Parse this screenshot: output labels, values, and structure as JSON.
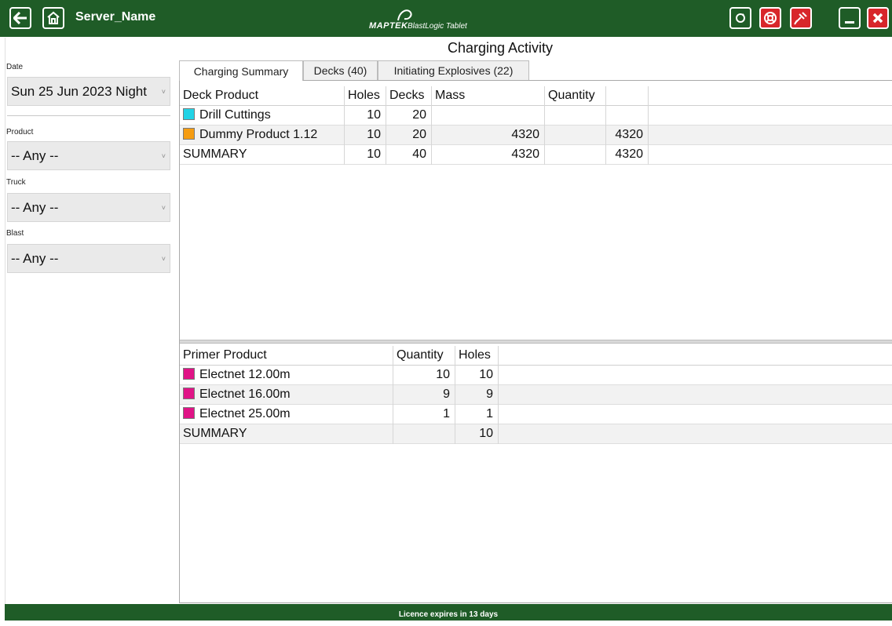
{
  "header": {
    "server_name": "Server_Name",
    "brand_main": "MAPTEK",
    "brand_sub": "BlastLogic Tablet",
    "buttons": {
      "back": "back-arrow-icon",
      "home": "home-icon",
      "sync": "sync-icon",
      "help": "lifebuoy-icon",
      "connection": "satellite-icon",
      "minimize": "minimize-icon",
      "close": "close-icon"
    },
    "colors": {
      "bar": "#1f5c27",
      "danger": "#d8262b"
    }
  },
  "page_title": "Charging Activity",
  "filters": {
    "date_label": "Date",
    "date_value": "Sun 25 Jun 2023 Night",
    "product_label": "Product",
    "product_value": "-- Any --",
    "truck_label": "Truck",
    "truck_value": "-- Any --",
    "blast_label": "Blast",
    "blast_value": "-- Any --"
  },
  "tabs": [
    {
      "label": "Charging Summary",
      "active": true
    },
    {
      "label": "Decks (40)",
      "active": false
    },
    {
      "label": "Initiating Explosives (22)",
      "active": false
    }
  ],
  "deck_table": {
    "headers": [
      "Deck Product",
      "Holes",
      "Decks",
      "Mass",
      "Quantity"
    ],
    "rows": [
      {
        "product": "Drill Cuttings",
        "color": "#22d3e6",
        "holes": "10",
        "decks": "20",
        "mass": "",
        "quantity": ""
      },
      {
        "product": "Dummy Product 1.12",
        "color": "#f59c12",
        "holes": "10",
        "decks": "20",
        "mass": "4320",
        "quantity": "4320"
      },
      {
        "product": "SUMMARY",
        "color": "",
        "holes": "10",
        "decks": "40",
        "mass": "4320",
        "quantity": "4320"
      }
    ]
  },
  "primer_table": {
    "headers": [
      "Primer Product",
      "Quantity",
      "Holes"
    ],
    "rows": [
      {
        "product": "Electnet 12.00m",
        "color": "#e01386",
        "quantity": "10",
        "holes": "10"
      },
      {
        "product": "Electnet 16.00m",
        "color": "#e01386",
        "quantity": "9",
        "holes": "9"
      },
      {
        "product": "Electnet 25.00m",
        "color": "#e01386",
        "quantity": "1",
        "holes": "1"
      },
      {
        "product": "SUMMARY",
        "color": "",
        "quantity": "",
        "holes": "10"
      }
    ]
  },
  "status_bar": "Licence expires in 13 days"
}
